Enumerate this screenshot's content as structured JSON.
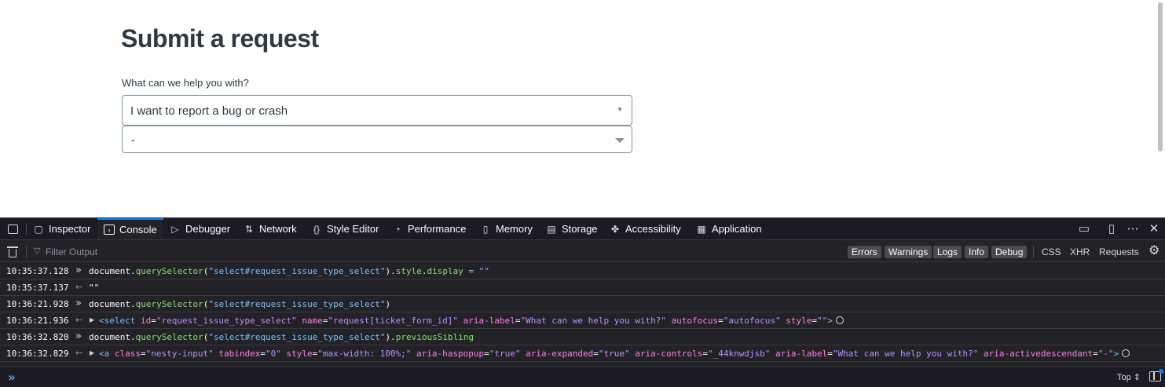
{
  "page": {
    "title": "Submit a request",
    "field_label": "What can we help you with?",
    "select_value": "I want to report a bug or crash",
    "nesty_value": "-"
  },
  "devtools": {
    "tabs": [
      {
        "label": "Inspector",
        "icon": "inspector-icon"
      },
      {
        "label": "Console",
        "icon": "console-icon",
        "active": true
      },
      {
        "label": "Debugger",
        "icon": "debugger-icon"
      },
      {
        "label": "Network",
        "icon": "network-icon"
      },
      {
        "label": "Style Editor",
        "icon": "style-editor-icon"
      },
      {
        "label": "Performance",
        "icon": "performance-icon"
      },
      {
        "label": "Memory",
        "icon": "memory-icon"
      },
      {
        "label": "Storage",
        "icon": "storage-icon"
      },
      {
        "label": "Accessibility",
        "icon": "accessibility-icon"
      },
      {
        "label": "Application",
        "icon": "application-icon"
      }
    ],
    "filter_placeholder": "Filter Output",
    "level_filters": [
      "Errors",
      "Warnings",
      "Logs",
      "Info",
      "Debug"
    ],
    "type_filters": [
      "CSS",
      "XHR",
      "Requests"
    ],
    "context": "Top ⇕",
    "accent_color": "#0a84ff"
  },
  "console": {
    "rows": [
      {
        "time": "10:35:37.128",
        "kind": "input"
      },
      {
        "time": "10:35:37.137",
        "kind": "result",
        "text": "\"\""
      },
      {
        "time": "10:36:21.928",
        "kind": "input"
      },
      {
        "time": "10:36:21.936",
        "kind": "result-element"
      },
      {
        "time": "10:36:32.820",
        "kind": "input"
      },
      {
        "time": "10:36:32.829",
        "kind": "result-element"
      }
    ],
    "tokens": {
      "doc": "document",
      "qs": "querySelector",
      "sel": "\"select#request_issue_type_select\"",
      "style": "style",
      "display": "display",
      "eq_empty": "= \"\"",
      "prev": "previousSibling",
      "select_tag": "select",
      "a_tag": "a",
      "id_attr": "id",
      "id_val": "\"request_issue_type_select\"",
      "name_attr": "name",
      "name_val": "\"request[ticket_form_id]\"",
      "aria_label_attr": "aria-label",
      "aria_label_val": "\"What can we help you with?\"",
      "autofocus_attr": "autofocus",
      "autofocus_val": "\"autofocus\"",
      "style_attr": "style",
      "style_empty_val": "\"\"",
      "class_attr": "class",
      "class_val": "\"nesty-input\"",
      "tabindex_attr": "tabindex",
      "tabindex_val": "\"0\"",
      "style_val": "\"max-width: 100%;\"",
      "haspopup_attr": "aria-haspopup",
      "haspopup_val": "\"true\"",
      "expanded_attr": "aria-expanded",
      "expanded_val": "\"true\"",
      "controls_attr": "aria-controls",
      "controls_val": "\"_44knwdjsb\"",
      "activedesc_attr": "aria-activedescendant",
      "activedesc_val": "\"-\""
    }
  }
}
